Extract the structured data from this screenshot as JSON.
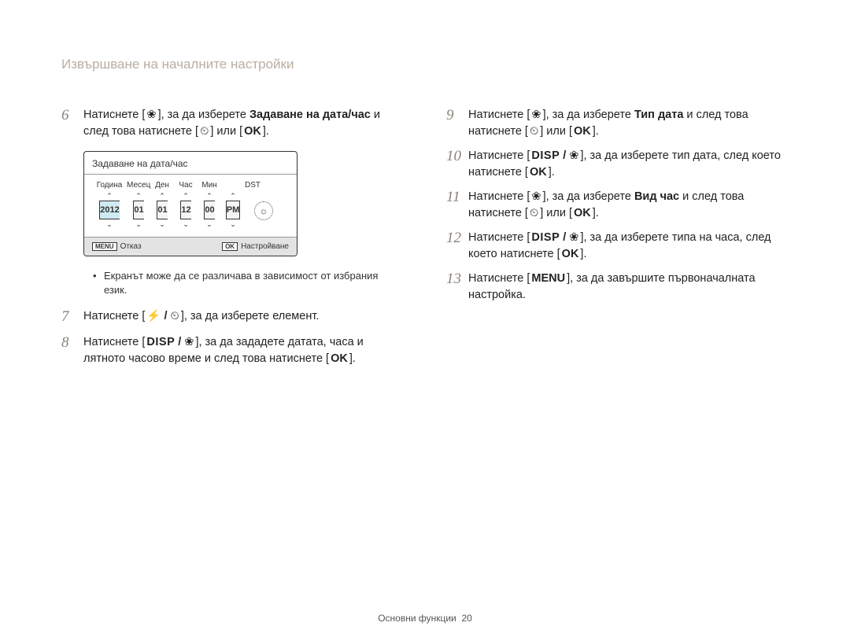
{
  "header": {
    "title": "Извършване на началните настройки"
  },
  "footer": {
    "section": "Основни функции",
    "page": "20"
  },
  "icons": {
    "flower": "❀",
    "timer": "⏲",
    "flash": "⚡",
    "ok": "OK",
    "disp": "DISP",
    "menu": "MENU",
    "slash": "/"
  },
  "left": {
    "step6": {
      "num": "6",
      "pre": "Натиснете [",
      "mid1": "], за да изберете ",
      "bold": "Задаване на дата/час",
      "mid2": " и след това натиснете [",
      "or": "] или [",
      "end": "]."
    },
    "screen": {
      "title": "Задаване на дата/час",
      "labels": {
        "year": "Година",
        "month": "Месец",
        "day": "Ден",
        "hour": "Час",
        "min": "Мин",
        "dst": "DST"
      },
      "values": {
        "year": "2012",
        "month": "01",
        "day": "01",
        "hour": "12",
        "min": "00",
        "ampm": "PM"
      },
      "dst_glyph": "☼",
      "footer": {
        "cancel_key": "MENU",
        "cancel": "Отказ",
        "ok_key": "OK",
        "ok": "Настройване"
      }
    },
    "note": "Екранът може да се различава в зависимост от избрания език.",
    "step7": {
      "num": "7",
      "pre": "Натиснете [",
      "sep": "/",
      "mid": "], за да изберете елемент."
    },
    "step8": {
      "num": "8",
      "pre": "Натиснете [",
      "mid1": "], за да зададете датата, часа и лятното часово време и след това натиснете [",
      "end": "]."
    }
  },
  "right": {
    "step9": {
      "num": "9",
      "pre": "Натиснете [",
      "mid1": "], за да изберете ",
      "bold": "Тип дата",
      "mid2": " и след това натиснете [",
      "or": "] или [",
      "end": "]."
    },
    "step10": {
      "num": "10",
      "pre": "Натиснете [",
      "mid1": "], за да изберете тип дата, след което натиснете [",
      "end": "]."
    },
    "step11": {
      "num": "11",
      "pre": "Натиснете [",
      "mid1": "], за да изберете ",
      "bold": "Вид час",
      "mid2": " и след това натиснете [",
      "or": "] или [",
      "end": "]."
    },
    "step12": {
      "num": "12",
      "pre": "Натиснете [",
      "mid1": "], за да изберете типа на часа, след което натиснете [",
      "end": "]."
    },
    "step13": {
      "num": "13",
      "pre": "Натиснете [",
      "mid": "], за да завършите първоначалната настройка."
    }
  }
}
